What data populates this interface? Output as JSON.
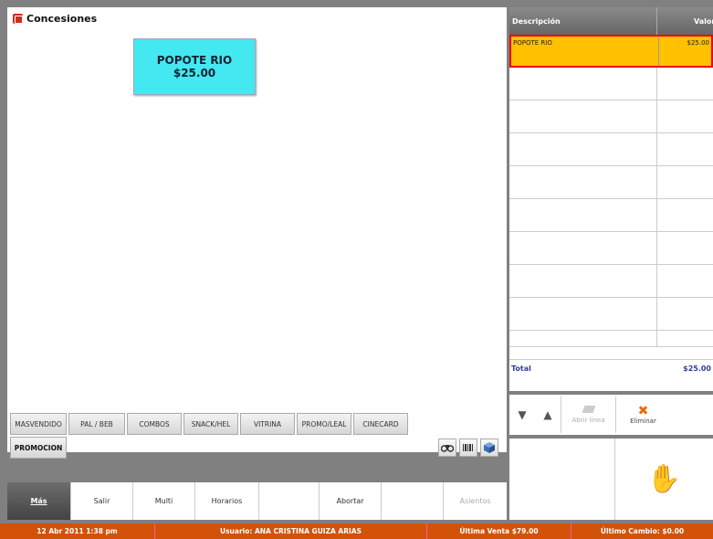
{
  "window": {
    "title": "Concesiones"
  },
  "product": {
    "name": "POPOTE RIO",
    "price": "$25.00"
  },
  "categories": [
    "MASVENDIDO",
    "PAL / BEB",
    "COMBOS",
    "SNACK/HEL",
    "VITRINA",
    "PROMO/LEAL",
    "CINECARD"
  ],
  "promo_label": "PROMOCION",
  "grid": {
    "header_desc": "Descripción",
    "header_val": "Valor",
    "rows": [
      {
        "desc": "POPOTE RIO",
        "val": "$25.00"
      }
    ],
    "total_label": "Total",
    "total_value": "$25.00"
  },
  "actions": {
    "open_line": "Abrir línea",
    "delete": "Eliminar"
  },
  "menu": [
    "Más",
    "Salir",
    "Multi",
    "Horarios",
    "",
    "Abortar",
    "",
    "Asientos"
  ],
  "status": {
    "datetime": "12 Abr 2011 1:38 pm",
    "user": "Usuario: ANA CRISTINA  GUIZA ARIAS",
    "last_sale": "Última Venta $79.00",
    "last_change": "Último Cambio: $0.00"
  }
}
